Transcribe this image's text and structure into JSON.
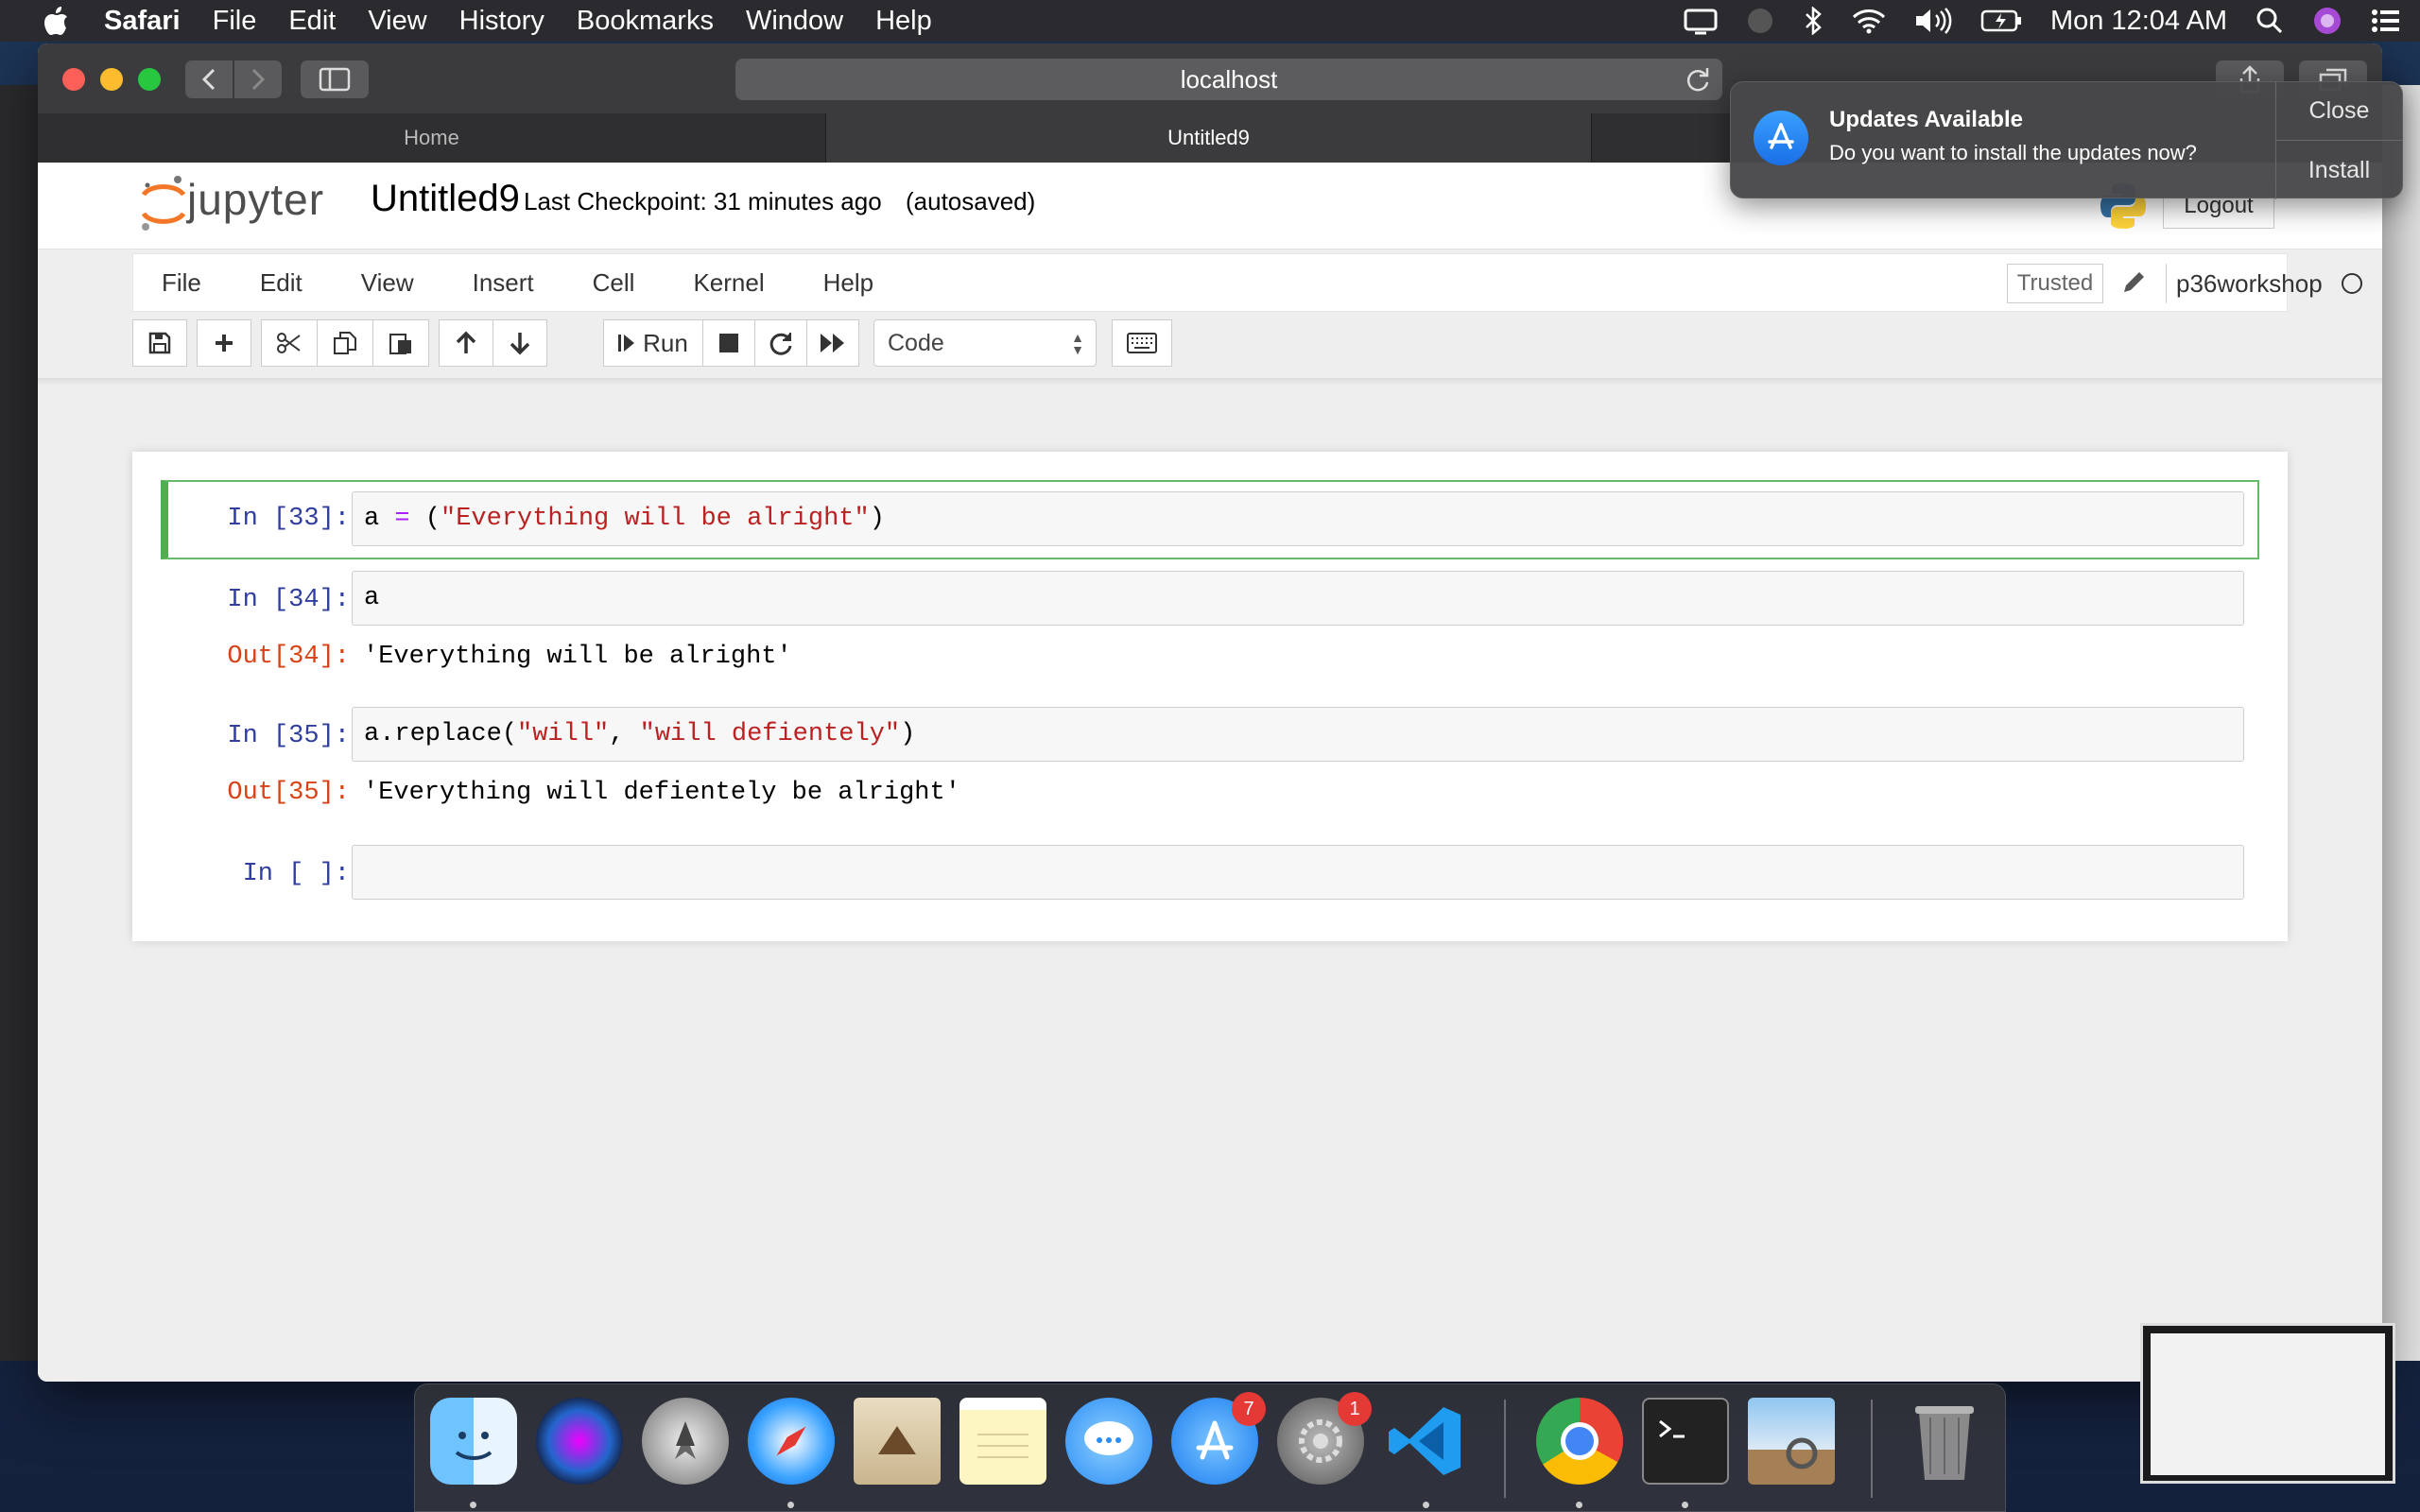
{
  "menubar": {
    "app_name": "Safari",
    "items": [
      "File",
      "Edit",
      "View",
      "History",
      "Bookmarks",
      "Window",
      "Help"
    ],
    "clock": "Mon 12:04 AM"
  },
  "browser": {
    "url": "localhost",
    "tabs": [
      {
        "label": "Home",
        "active": false
      },
      {
        "label": "Untitled9",
        "active": true
      }
    ]
  },
  "jupyter": {
    "logo_text": "jupyter",
    "notebook_title": "Untitled9",
    "checkpoint": "Last Checkpoint: 31 minutes ago",
    "autosave": "(autosaved)",
    "logout_label": "Logout",
    "menu": [
      "File",
      "Edit",
      "View",
      "Insert",
      "Cell",
      "Kernel",
      "Help"
    ],
    "trusted_label": "Trusted",
    "kernel_name": "p36workshop",
    "toolbar": {
      "run_label": "Run",
      "cell_type": "Code"
    }
  },
  "cells": [
    {
      "in_prompt": "In [33]:",
      "code": "a = (\"Everything will be alright\")",
      "selected": true
    },
    {
      "in_prompt": "In [34]:",
      "code": "a",
      "out_prompt": "Out[34]:",
      "output": "'Everything will be alright'"
    },
    {
      "in_prompt": "In [35]:",
      "code": "a.replace(\"will\", \"will defientely\")",
      "out_prompt": "Out[35]:",
      "output": "'Everything will defientely be alright'"
    },
    {
      "in_prompt": "In [ ]:",
      "code": ""
    }
  ],
  "notification": {
    "title": "Updates Available",
    "body": "Do you want to install the updates now?",
    "close_label": "Close",
    "install_label": "Install"
  },
  "dock": {
    "apps": [
      "finder-icon",
      "siri-icon",
      "launchpad-icon",
      "safari-icon",
      "mail-icon",
      "notes-icon",
      "messages-icon",
      "app-store-icon",
      "system-preferences-icon",
      "vscode-icon",
      "chrome-icon",
      "terminal-icon",
      "preview-icon",
      "trash-icon"
    ],
    "badges": {
      "app_store": "7",
      "system_preferences": "1"
    }
  },
  "colors": {
    "selected_cell_border": "#4caf50",
    "in_prompt": "#303f9f",
    "out_prompt": "#d84315",
    "string": "#ba2121"
  }
}
